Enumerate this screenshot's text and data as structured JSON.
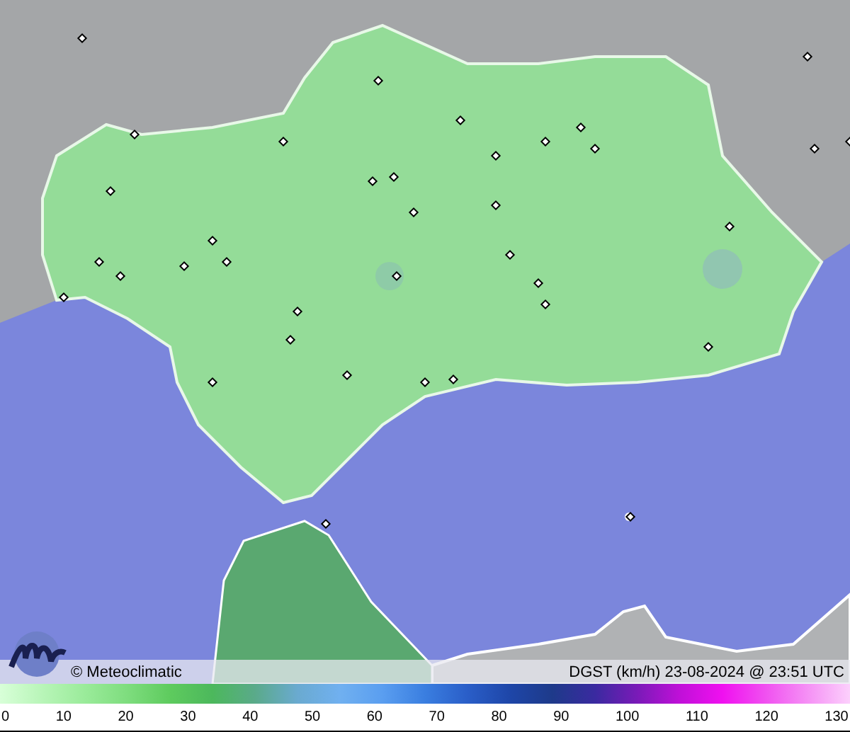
{
  "map": {
    "credit": "© Meteoclimatic",
    "caption": "DGST (km/h)  23-08-2024 @ 23:51 UTC"
  },
  "legend": {
    "ticks": [
      "0",
      "10",
      "20",
      "30",
      "40",
      "50",
      "60",
      "70",
      "80",
      "90",
      "100",
      "110",
      "120",
      "130"
    ]
  }
}
